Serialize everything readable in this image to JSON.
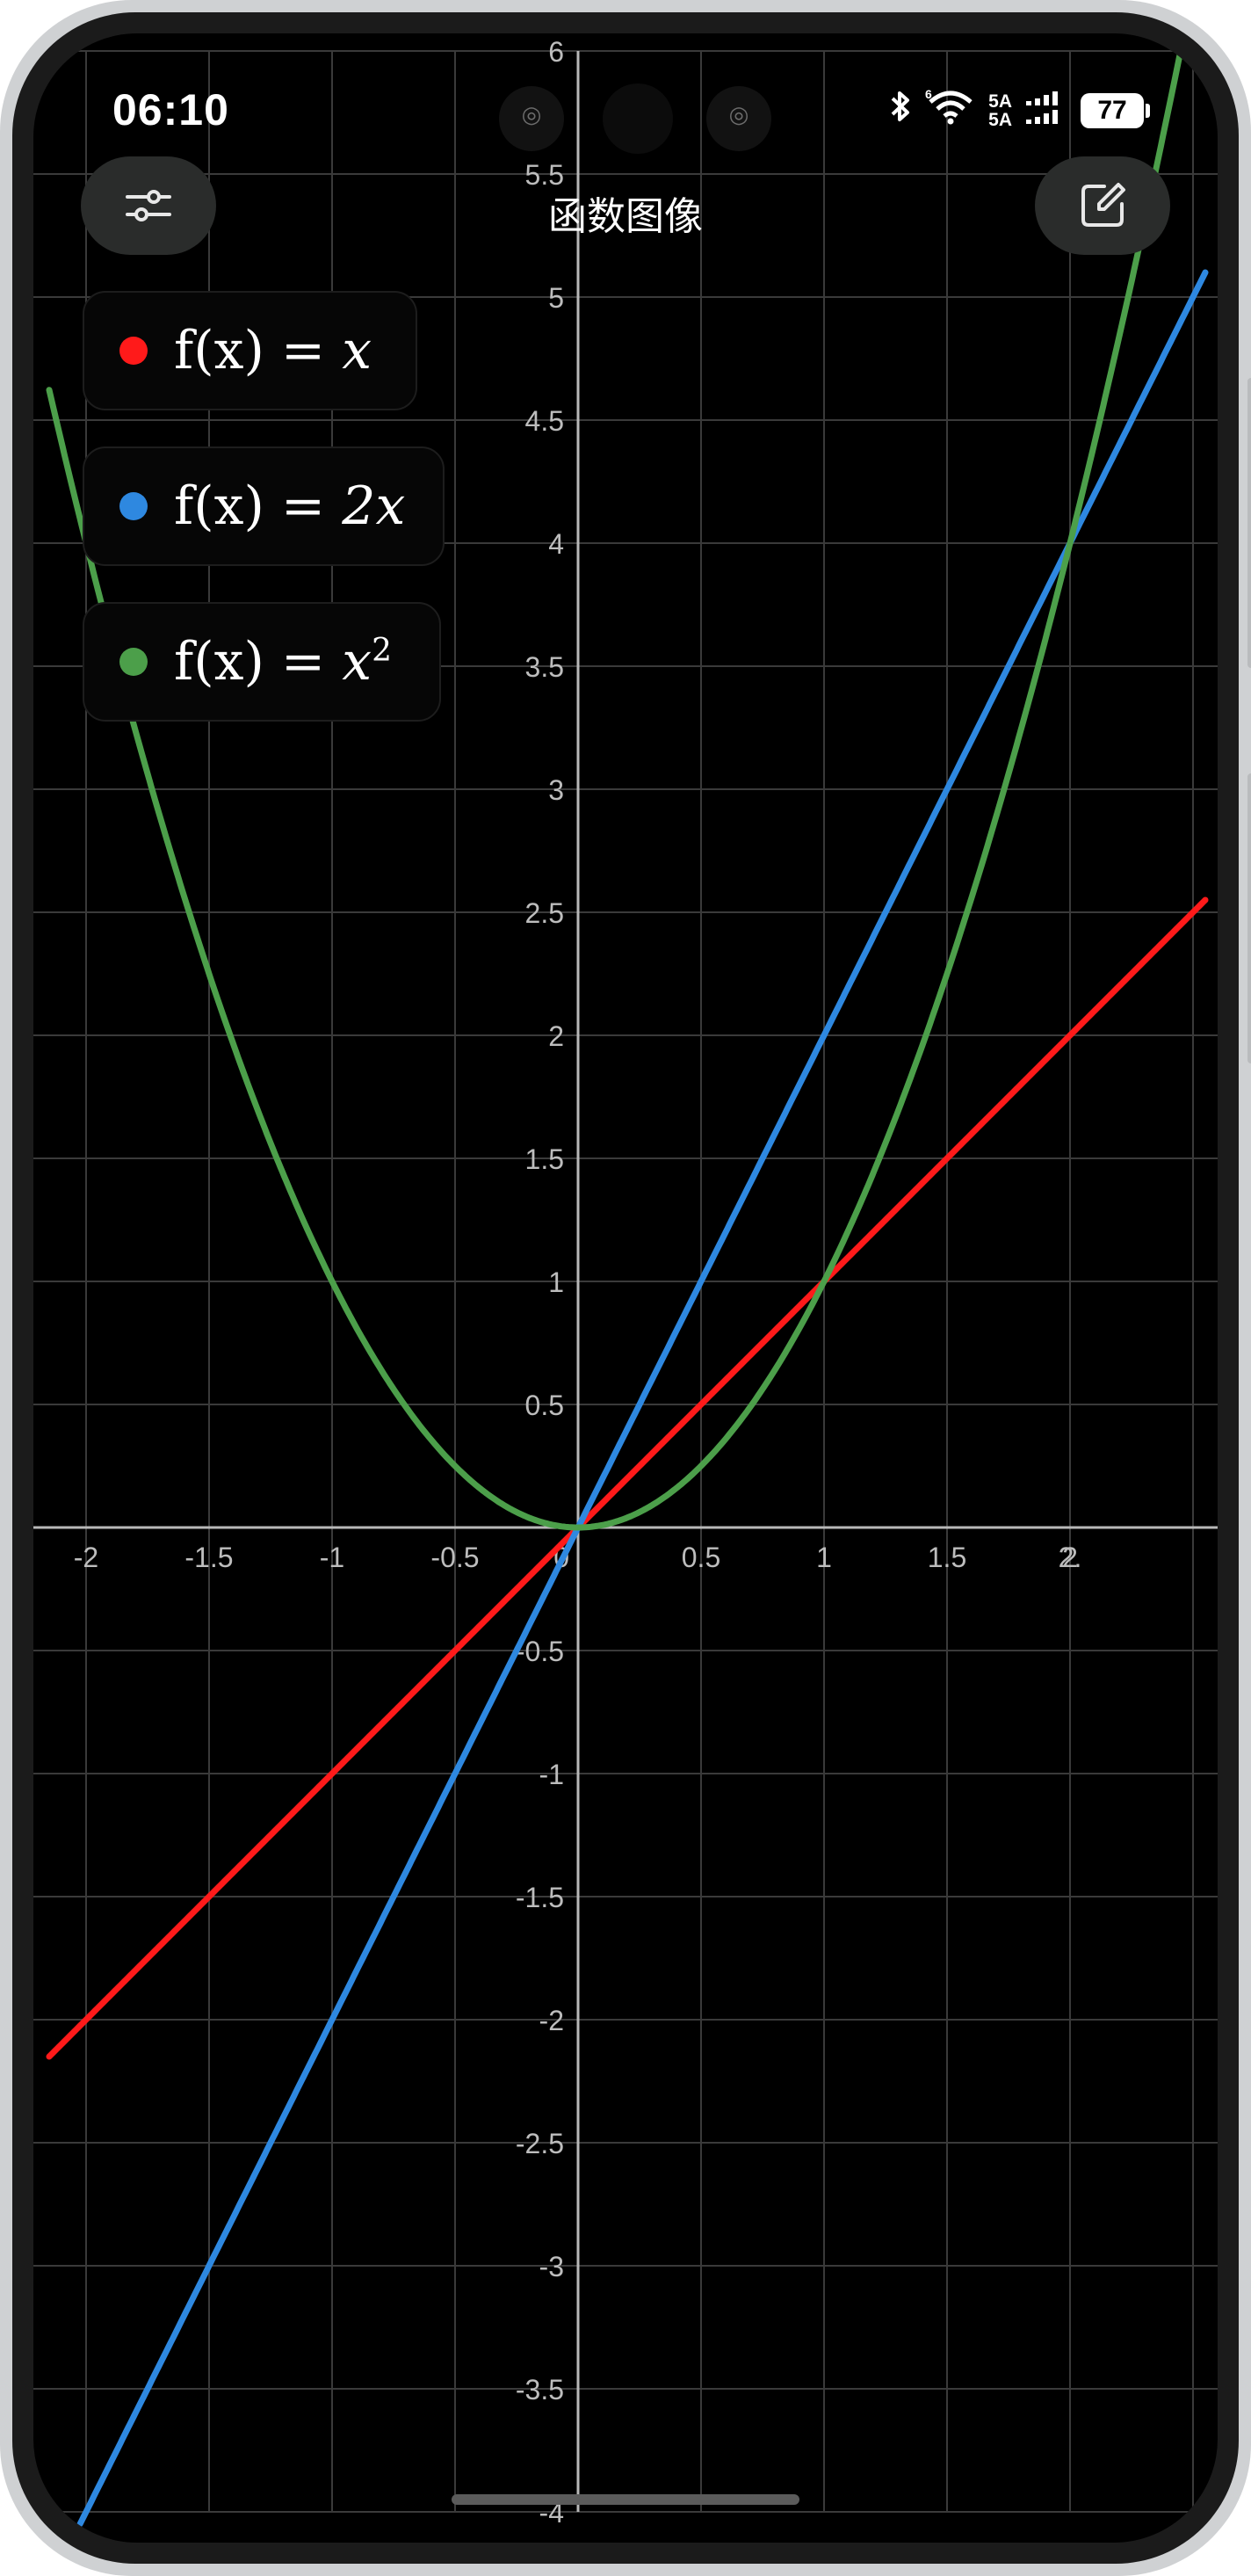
{
  "status_bar": {
    "time": "06:10",
    "network_top": "5A",
    "network_bottom": "5A",
    "battery_level": "77",
    "icons": [
      "bluetooth-icon",
      "wifi-icon",
      "signal-icon",
      "battery-icon"
    ]
  },
  "header": {
    "title": "函数图像",
    "left_button_icon": "sliders-icon",
    "right_button_icon": "edit-icon"
  },
  "legend": [
    {
      "prefix": "f(x) = ",
      "expr": "x",
      "sup": "",
      "color": "#ff1a1a"
    },
    {
      "prefix": "f(x) = ",
      "expr": "2x",
      "sup": "",
      "color": "#2e88e0"
    },
    {
      "prefix": "f(x) = ",
      "expr": "x",
      "sup": "2",
      "color": "#4c9f4a"
    }
  ],
  "chart_data": {
    "type": "line",
    "x_range": [
      -2.15,
      2.55
    ],
    "y_range": [
      -4,
      6
    ],
    "x_ticks": [
      "-2",
      "-1.5",
      "-1",
      "-0.5",
      "0",
      "0.5",
      "1",
      "1.5",
      "2",
      "2."
    ],
    "y_ticks": [
      "6",
      "5.5",
      "5",
      "4.5",
      "4",
      "3.5",
      "3",
      "2.5",
      "2",
      "1.5",
      "1",
      "0.5",
      "-0.5",
      "-1",
      "-1.5",
      "-2",
      "-2.5",
      "-3",
      "-3.5",
      "-4"
    ],
    "grid": true,
    "series": [
      {
        "name": "f(x) = x",
        "function": "x",
        "color": "#ff1a1a"
      },
      {
        "name": "f(x) = 2x",
        "function": "2x",
        "color": "#2e88e0"
      },
      {
        "name": "f(x) = x^2",
        "function": "x^2",
        "color": "#4c9f4a"
      }
    ]
  }
}
